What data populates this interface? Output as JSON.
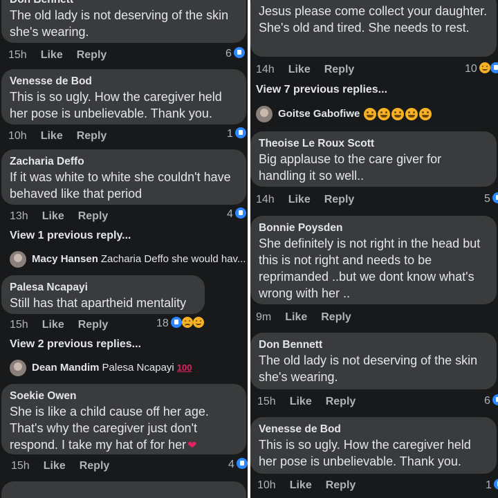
{
  "left": {
    "c1": {
      "author": "Don Bennett",
      "text": "The old lady is not deserving of the skin she's wearing.",
      "time": "15h",
      "like": "Like",
      "reply": "Reply",
      "count": "6"
    },
    "c2": {
      "author": "Venesse de Bod",
      "text": "This is so ugly. How the caregiver held her pose is unbelievable. Thank you.",
      "time": "10h",
      "like": "Like",
      "reply": "Reply",
      "count": "1"
    },
    "c3": {
      "author": "Zacharia Deffo",
      "text": "If it was white to white she couldn't have behaved like that period",
      "time": "13h",
      "like": "Like",
      "reply": "Reply",
      "count": "4"
    },
    "c3_view": "View 1 previous reply...",
    "c3_reply": {
      "name": "Macy Hansen",
      "text": "Zacharia Deffo she would hav..."
    },
    "c4": {
      "author": "Palesa Ncapayi",
      "text": "Still has that apartheid mentality",
      "time": "15h",
      "like": "Like",
      "reply": "Reply",
      "count": "18"
    },
    "c4_view": "View 2 previous replies...",
    "c4_reply": {
      "name": "Dean Mandim",
      "text": "Palesa Ncapayi",
      "emoji": "100"
    },
    "c5": {
      "author": "Soekie Owen",
      "text": "She is like a child cause off her age. That's why the caregiver just don't respond. I take my hat of for her",
      "time": "15h",
      "like": "Like",
      "reply": "Reply",
      "count": "4"
    }
  },
  "right": {
    "c1": {
      "text": "Jesus please come collect your daughter. She's old and tired. She needs to rest.",
      "time": "14h",
      "like": "Like",
      "reply": "Reply",
      "count": "10"
    },
    "c1_view": "View 7 previous replies...",
    "c1_reply": {
      "name": "Goitse Gabofiwe"
    },
    "c2": {
      "author": "Theoise Le Roux Scott",
      "text": "Big applause to the care giver for handling it so well..",
      "time": "14h",
      "like": "Like",
      "reply": "Reply",
      "count": "5"
    },
    "c3": {
      "author": "Bonnie Poysden",
      "text": "She definitely is not right in the head but this is not right and needs to be reprimanded ..but we dont know what's wrong with her ..",
      "time": "9m",
      "like": "Like",
      "reply": "Reply"
    },
    "c4": {
      "author": "Don Bennett",
      "text": "The old lady is not deserving of the skin she's wearing.",
      "time": "15h",
      "like": "Like",
      "reply": "Reply",
      "count": "6"
    },
    "c5": {
      "author": "Venesse de Bod",
      "text": "This is so ugly. How the caregiver held her pose is unbelievable. Thank you.",
      "time": "10h",
      "like": "Like",
      "reply": "Reply",
      "count": "1"
    }
  }
}
